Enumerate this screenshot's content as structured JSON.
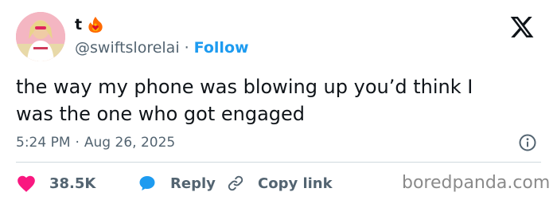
{
  "author": {
    "display_name": "t",
    "handle": "@swiftslorelai",
    "handle_separator": "·",
    "follow_label": "Follow",
    "avatar": "avatar-photo",
    "badge_icon": "fire-heart-icon"
  },
  "platform_logo": "x-logo",
  "tweet": {
    "lines": [
      "the way my phone was blowing up you’d think I",
      "was the one who got engaged"
    ]
  },
  "meta": {
    "time": "5:24 PM",
    "separator": "·",
    "date": "Aug 26, 2025",
    "info_icon": "info-icon"
  },
  "actions": {
    "like_count": "38.5K",
    "like_icon": "heart-icon",
    "reply_label": "Reply",
    "reply_icon": "speech-bubble-icon",
    "copy_label": "Copy link",
    "copy_icon": "link-icon"
  },
  "watermark": "boredpanda.com",
  "colors": {
    "text": "#0f1419",
    "secondary": "#536471",
    "accent": "#1d9bf0",
    "like": "#f91880",
    "divider": "#cfd9de"
  }
}
